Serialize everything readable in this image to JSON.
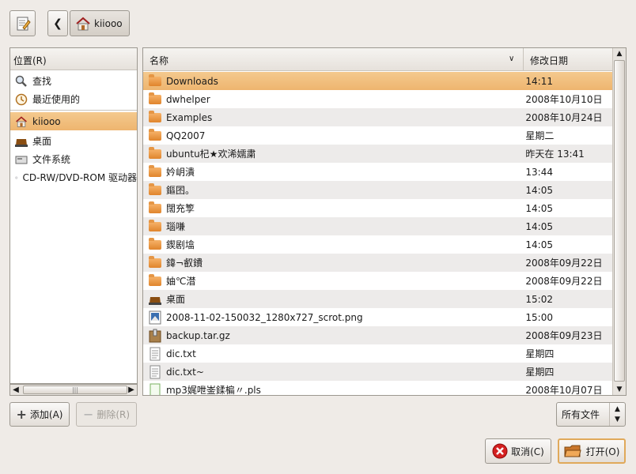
{
  "toolbar": {
    "edit_icon": "text-editor-icon",
    "back_icon": "chevron-left-icon",
    "breadcrumb_label": "kiiooo"
  },
  "places": {
    "header": "位置(R)",
    "items": [
      {
        "label": "查找",
        "icon": "search-icon"
      },
      {
        "label": "最近使用的",
        "icon": "recent-icon"
      },
      {
        "label": "kiiooo",
        "icon": "home-icon",
        "selected": true
      },
      {
        "label": "桌面",
        "icon": "desktop-icon"
      },
      {
        "label": "文件系统",
        "icon": "filesystem-icon"
      },
      {
        "label": "CD-RW/DVD-ROM 驱动器",
        "icon": "cd-drive-icon"
      }
    ]
  },
  "files": {
    "col_name": "名称",
    "col_date": "修改日期",
    "rows": [
      {
        "name": "Downloads",
        "date": "14:11",
        "type": "folder",
        "selected": true
      },
      {
        "name": "dwhelper",
        "date": "2008年10月10日",
        "type": "folder"
      },
      {
        "name": "Examples",
        "date": "2008年10月24日",
        "type": "folder"
      },
      {
        "name": "QQ2007",
        "date": "星期二",
        "type": "folder"
      },
      {
        "name": "ubuntu杞★欢浠嬬粛",
        "date": "昨天在 13:41",
        "type": "folder"
      },
      {
        "name": "妗岄潰",
        "date": "13:44",
        "type": "folder"
      },
      {
        "name": "鏂囨。",
        "date": "14:05",
        "type": "folder"
      },
      {
        "name": "闊充箰",
        "date": "14:05",
        "type": "folder"
      },
      {
        "name": "瑙嗛 ",
        "date": "14:05",
        "type": "folder"
      },
      {
        "name": "鍥剧墖",
        "date": "14:05",
        "type": "folder"
      },
      {
        "name": "鍏¬叡鐨",
        "date": "2008年09月22日",
        "type": "folder"
      },
      {
        "name": "妯℃澘",
        "date": "2008年09月22日",
        "type": "folder"
      },
      {
        "name": "桌面",
        "date": "15:02",
        "type": "desktop"
      },
      {
        "name": "2008-11-02-150032_1280x727_scrot.png",
        "date": "15:00",
        "type": "image"
      },
      {
        "name": "backup.tar.gz",
        "date": "2008年09月23日",
        "type": "archive"
      },
      {
        "name": "dic.txt",
        "date": "星期四",
        "type": "text"
      },
      {
        "name": "dic.txt~",
        "date": "星期四",
        "type": "text"
      },
      {
        "name": "mp3娓呭崟鍒楄〃.pls",
        "date": "2008年10月07日",
        "type": "playlist"
      }
    ]
  },
  "buttons": {
    "add": "添加(A)",
    "remove": "删除(R)",
    "filter": "所有文件",
    "cancel": "取消(C)",
    "open": "打开(O)"
  },
  "colors": {
    "selection": "#eeb56f",
    "folder": "#e0842c",
    "window_bg": "#efebe7"
  }
}
